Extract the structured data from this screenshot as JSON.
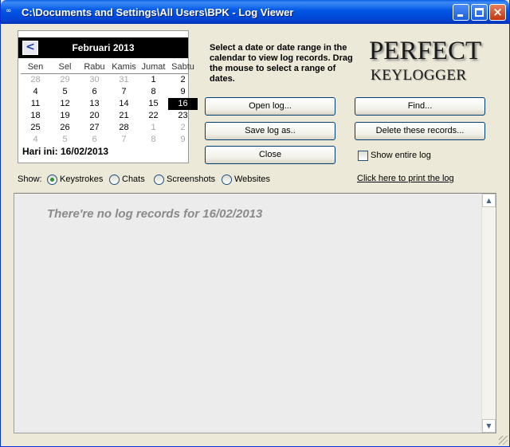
{
  "window": {
    "title": "C:\\Documents and Settings\\All Users\\BPK - Log Viewer",
    "icon": "keylogger-app-icon"
  },
  "titlebar_buttons": {
    "minimize_icon": "minimize-icon",
    "maximize_icon": "maximize-icon",
    "close_icon": "close-icon",
    "close_glyph": "×"
  },
  "calendar": {
    "month_label": "Februari 2013",
    "prev_glyph": "<",
    "days_of_week": [
      "Sen",
      "Sel",
      "Rabu",
      "Kamis",
      "Jumat",
      "Sabtu"
    ],
    "weeks": [
      [
        {
          "d": "28",
          "o": true
        },
        {
          "d": "29",
          "o": true
        },
        {
          "d": "30",
          "o": true
        },
        {
          "d": "31",
          "o": true
        },
        {
          "d": "1",
          "o": false
        },
        {
          "d": "2",
          "o": false
        }
      ],
      [
        {
          "d": "4",
          "o": false
        },
        {
          "d": "5",
          "o": false
        },
        {
          "d": "6",
          "o": false
        },
        {
          "d": "7",
          "o": false
        },
        {
          "d": "8",
          "o": false
        },
        {
          "d": "9",
          "o": false
        }
      ],
      [
        {
          "d": "11",
          "o": false
        },
        {
          "d": "12",
          "o": false
        },
        {
          "d": "13",
          "o": false
        },
        {
          "d": "14",
          "o": false
        },
        {
          "d": "15",
          "o": false
        },
        {
          "d": "16",
          "o": false,
          "sel": true
        }
      ],
      [
        {
          "d": "18",
          "o": false
        },
        {
          "d": "19",
          "o": false
        },
        {
          "d": "20",
          "o": false
        },
        {
          "d": "21",
          "o": false
        },
        {
          "d": "22",
          "o": false
        },
        {
          "d": "23",
          "o": false
        }
      ],
      [
        {
          "d": "25",
          "o": false
        },
        {
          "d": "26",
          "o": false
        },
        {
          "d": "27",
          "o": false
        },
        {
          "d": "28",
          "o": false
        },
        {
          "d": "1",
          "o": true
        },
        {
          "d": "2",
          "o": true
        }
      ],
      [
        {
          "d": "4",
          "o": true
        },
        {
          "d": "5",
          "o": true
        },
        {
          "d": "6",
          "o": true
        },
        {
          "d": "7",
          "o": true
        },
        {
          "d": "8",
          "o": true
        },
        {
          "d": "9",
          "o": true
        }
      ]
    ],
    "today_label": "Hari ini: 16/02/2013"
  },
  "instructions": "Select a date or date range in the calendar to view log records. Drag the mouse to select a range of dates.",
  "logo": {
    "line1": "PERFECT",
    "line2": "KEYLOGGER"
  },
  "buttons": {
    "open": "Open log...",
    "save": "Save log as..",
    "close": "Close",
    "find": "Find...",
    "delete": "Delete these records..."
  },
  "show_entire_log": {
    "label": "Show entire log",
    "checked": false
  },
  "print_link": "Click here to print the log",
  "show": {
    "label": "Show:",
    "options": [
      "Keystrokes",
      "Chats",
      "Screenshots",
      "Websites"
    ],
    "selected": "Keystrokes"
  },
  "log": {
    "empty_message": "There're no log records for 16/02/2013"
  },
  "scrollbar": {
    "up_glyph": "▲",
    "down_glyph": "▼"
  }
}
